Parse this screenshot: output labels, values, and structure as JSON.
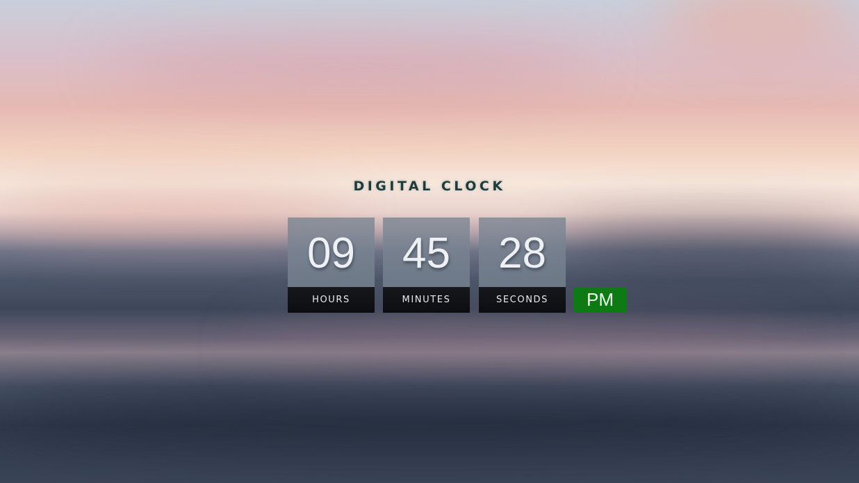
{
  "title": "DIGITAL CLOCK",
  "clock": {
    "hours": {
      "value": "09",
      "label": "HOURS"
    },
    "minutes": {
      "value": "45",
      "label": "MINUTES"
    },
    "seconds": {
      "value": "28",
      "label": "SECONDS"
    },
    "period": "PM"
  },
  "colors": {
    "title_text": "#1f3a3a",
    "digit_panel": "#78849294",
    "label_panel": "#0c0d10",
    "period_badge": "#0d7a14"
  }
}
